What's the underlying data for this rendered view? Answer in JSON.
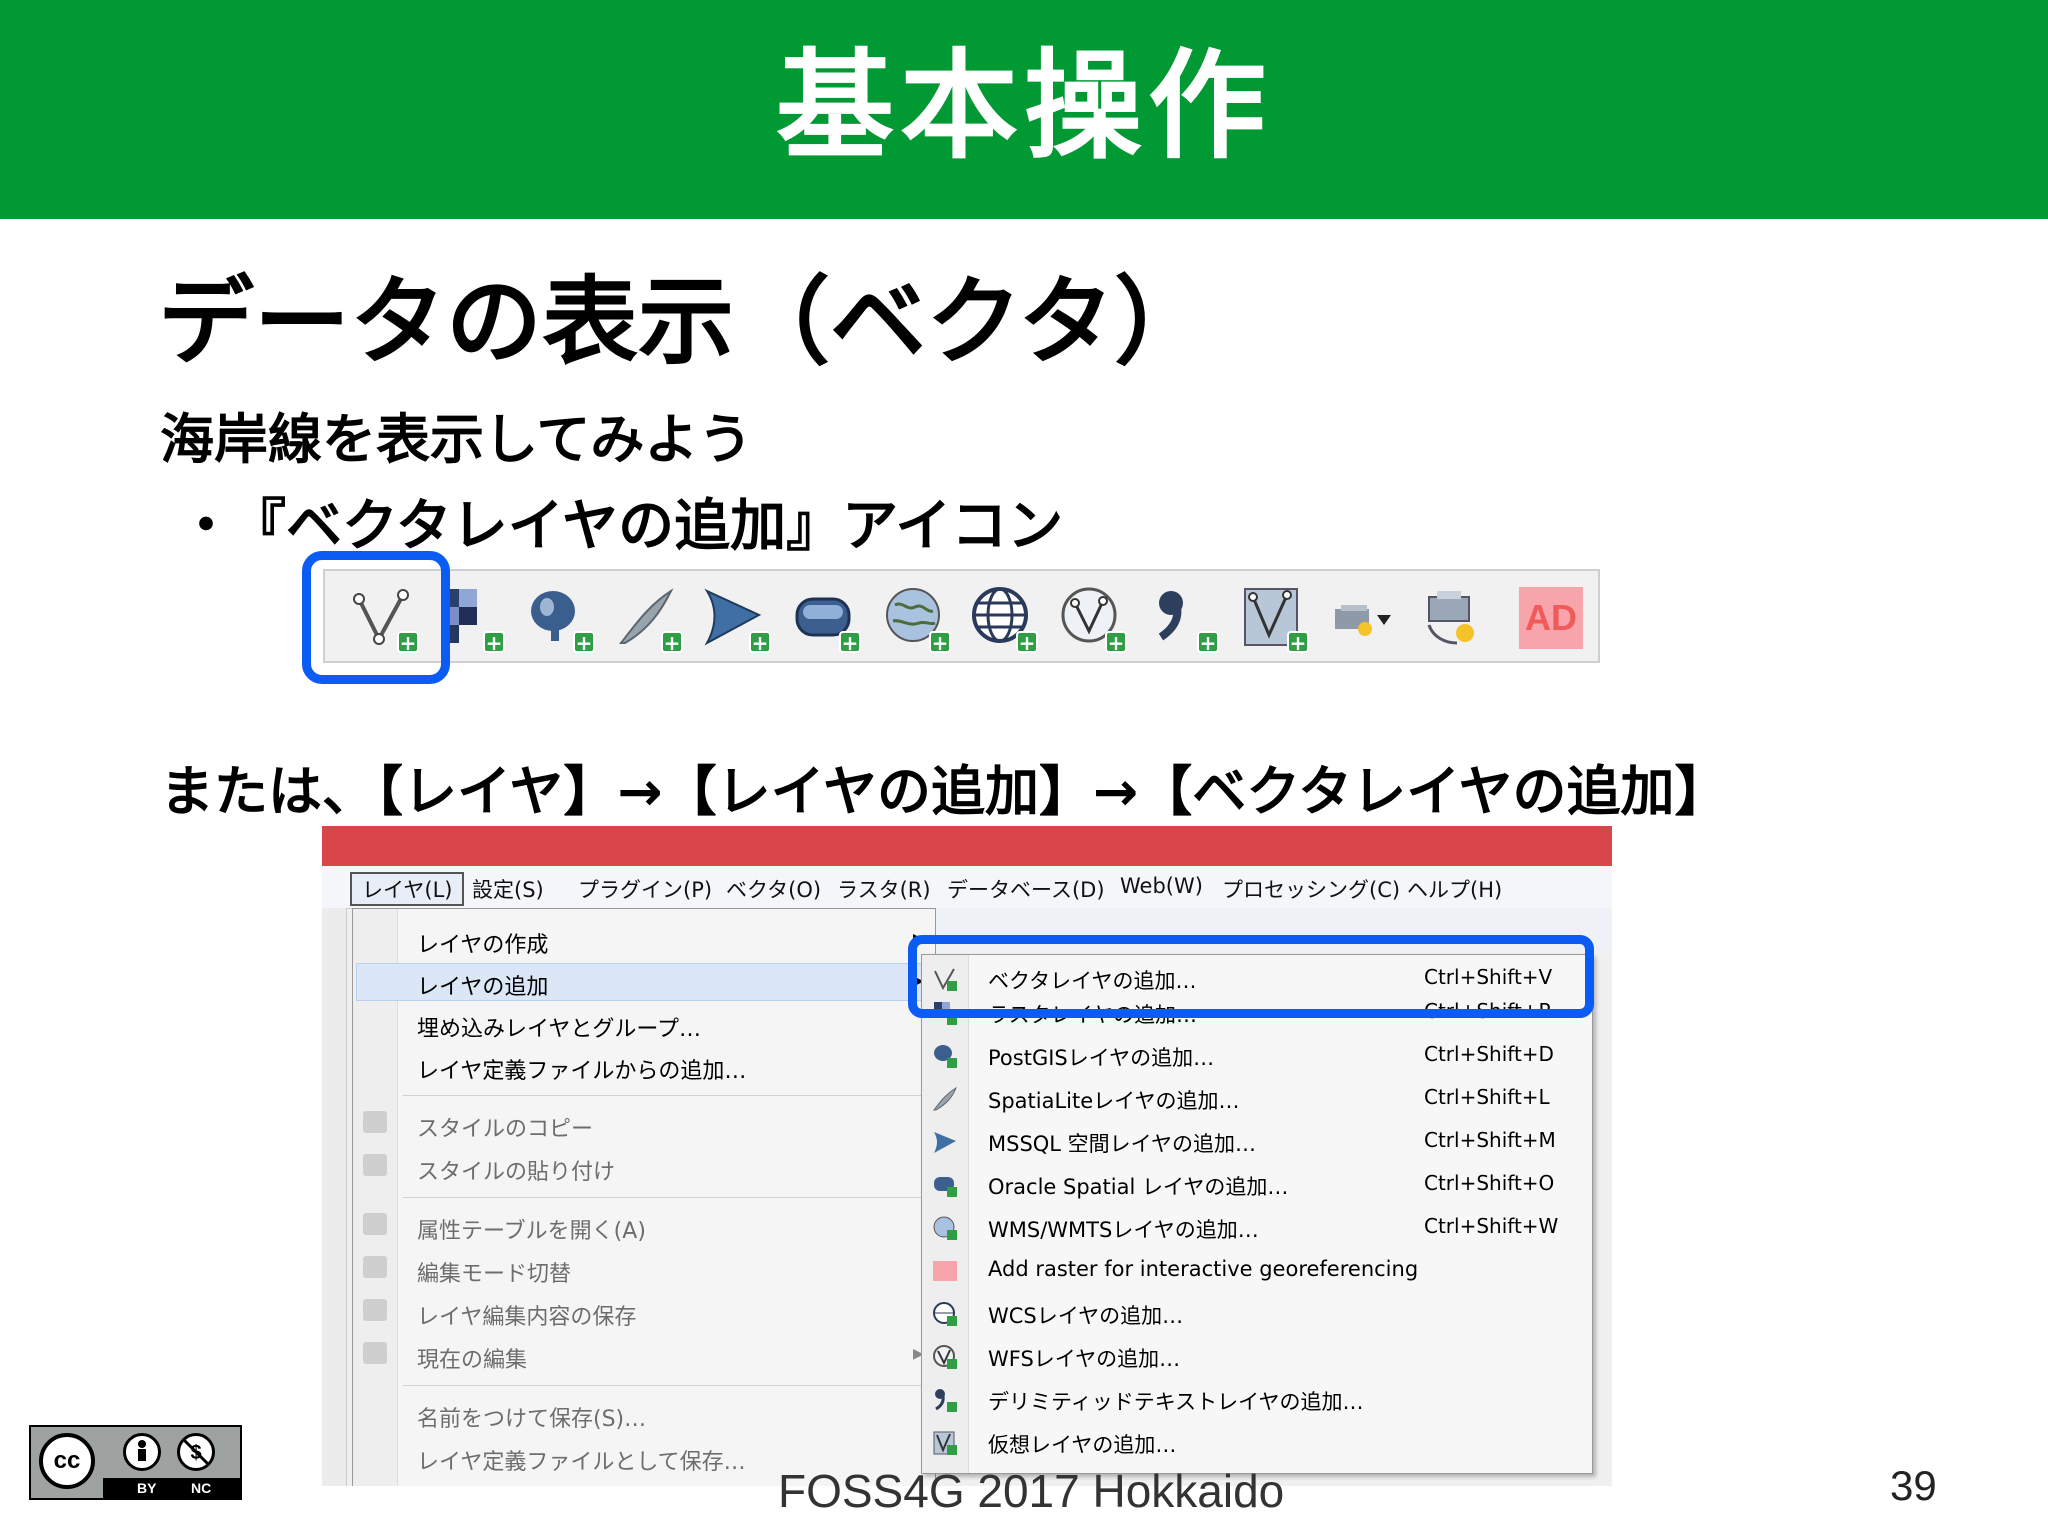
{
  "header": {
    "title": "基本操作",
    "bg_color": "#009933"
  },
  "slide": {
    "title": "データの表示（ベクタ）",
    "subtitle": "海岸線を表示してみよう",
    "bullet_mark": "・",
    "bullet": "『ベクタレイヤの追加』アイコン",
    "alt_path": "または、【レイヤ】→【レイヤの追加】→【ベクタレイヤの追加】",
    "highlight_color": "#0a5cf5"
  },
  "toolbar": {
    "icons": [
      "add-vector-layer-icon",
      "add-raster-layer-icon",
      "add-postgis-layer-icon",
      "add-spatialite-layer-icon",
      "add-mssql-layer-icon",
      "add-oracle-layer-icon",
      "add-wms-layer-icon",
      "add-wcs-layer-icon",
      "add-wfs-layer-icon",
      "add-delimited-text-layer-icon",
      "add-virtual-layer-icon",
      "new-layer-dropdown-icon",
      "new-temporary-layer-icon"
    ],
    "ad_label": "AD"
  },
  "menubar": {
    "items": [
      "レイヤ(L)",
      "設定(S)",
      "プラグイン(P)",
      "ベクタ(O)",
      "ラスタ(R)",
      "データベース(D)",
      "Web(W)",
      "プロセッシング(C)",
      "ヘルプ(H)"
    ]
  },
  "layer_menu": {
    "items": [
      {
        "label": "レイヤの作成",
        "disabled": false
      },
      {
        "label": "レイヤの追加",
        "disabled": false
      },
      {
        "label": "埋め込みレイヤとグループ…",
        "disabled": false
      },
      {
        "label": "レイヤ定義ファイルからの追加…",
        "disabled": false
      },
      {
        "label": "スタイルのコピー",
        "disabled": true
      },
      {
        "label": "スタイルの貼り付け",
        "disabled": true
      },
      {
        "label": "属性テーブルを開く(A)",
        "disabled": true
      },
      {
        "label": "編集モード切替",
        "disabled": true
      },
      {
        "label": "レイヤ編集内容の保存",
        "disabled": true
      },
      {
        "label": "現在の編集",
        "disabled": true
      },
      {
        "label": "名前をつけて保存(S)…",
        "disabled": true
      },
      {
        "label": "レイヤ定義ファイルとして保存…",
        "disabled": true
      }
    ],
    "arrow": "▶"
  },
  "add_layer_submenu": {
    "items": [
      {
        "label": "ベクタレイヤの追加…",
        "shortcut": "Ctrl+Shift+V"
      },
      {
        "label": "ラスタレイヤの追加…",
        "shortcut": "Ctrl+Shift+R"
      },
      {
        "label": "PostGISレイヤの追加…",
        "shortcut": "Ctrl+Shift+D"
      },
      {
        "label": "SpatiaLiteレイヤの追加…",
        "shortcut": "Ctrl+Shift+L"
      },
      {
        "label": "MSSQL 空間レイヤの追加…",
        "shortcut": "Ctrl+Shift+M"
      },
      {
        "label": "Oracle Spatial レイヤの追加…",
        "shortcut": "Ctrl+Shift+O"
      },
      {
        "label": "WMS/WMTSレイヤの追加…",
        "shortcut": "Ctrl+Shift+W"
      },
      {
        "label": "Add raster for interactive georeferencing",
        "shortcut": ""
      },
      {
        "label": "WCSレイヤの追加…",
        "shortcut": ""
      },
      {
        "label": "WFSレイヤの追加…",
        "shortcut": ""
      },
      {
        "label": "デリミティッドテキストレイヤの追加…",
        "shortcut": ""
      },
      {
        "label": "仮想レイヤの追加…",
        "shortcut": ""
      }
    ]
  },
  "footer": {
    "cc_mark": "cc",
    "cc_by": "BY",
    "cc_nc": "NC",
    "text": "FOSS4G 2017 Hokkaido",
    "page": "39"
  }
}
